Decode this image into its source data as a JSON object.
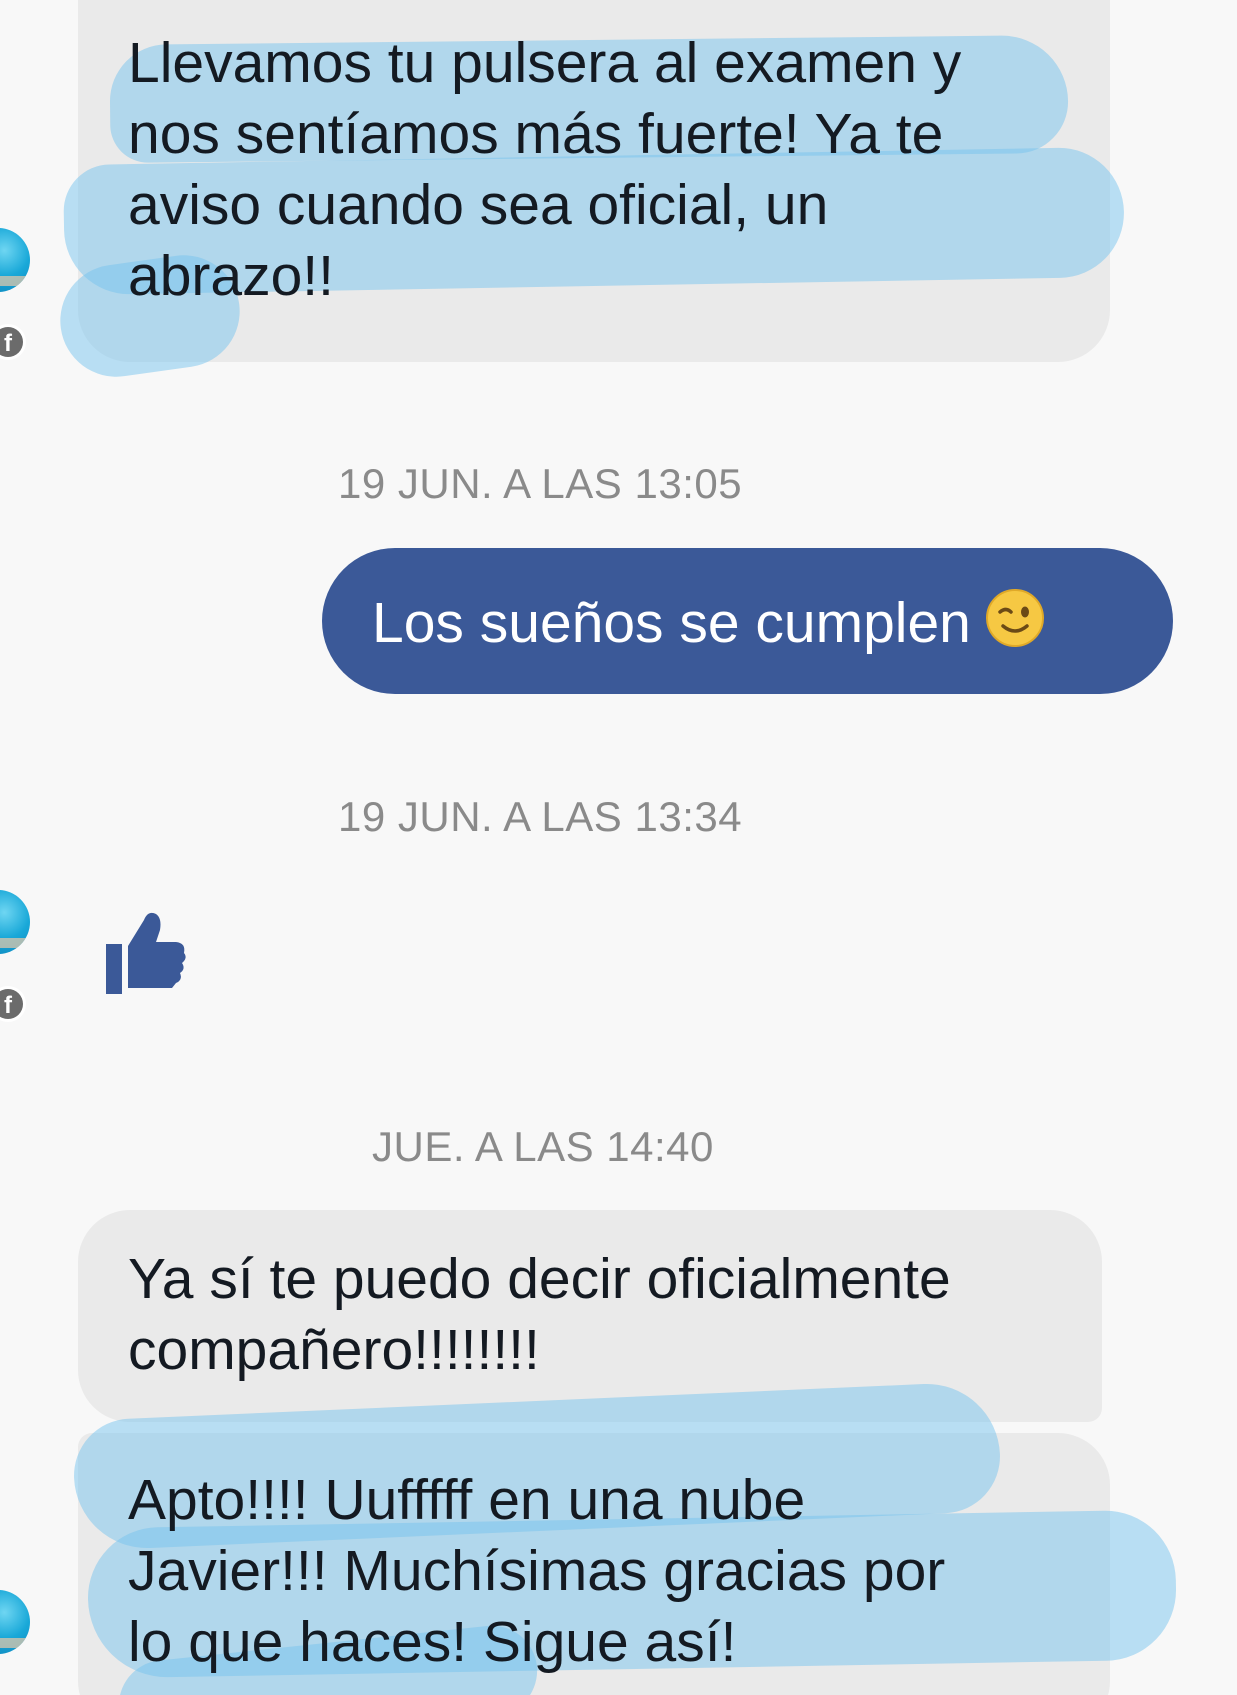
{
  "messages": [
    {
      "direction": "incoming",
      "text": "Llevamos tu pulsera al examen y\nnos sentíamos más fuerte! Ya te\naviso cuando sea oficial, un\nabrazo!!"
    },
    {
      "timestamp": "19 JUN. A LAS 13:05"
    },
    {
      "direction": "outgoing",
      "text": "Los sueños se cumplen",
      "emoji": "winking-face-emoji"
    },
    {
      "timestamp": "19 JUN. A LAS 13:34"
    },
    {
      "direction": "incoming",
      "sticker": "thumbs-up-icon"
    },
    {
      "timestamp": "JUE. A LAS 14:40"
    },
    {
      "direction": "incoming",
      "text": "Ya sí te puedo decir oficialmente\ncompañero!!!!!!!!"
    },
    {
      "direction": "incoming",
      "text": "Apto!!!! Uufffff en una nube\nJavier!!! Muchísimas gracias por\nlo que haces! Sigue así!"
    }
  ],
  "colors": {
    "background": "#f8f8f8",
    "incoming_bubble": "#eaeaea",
    "outgoing_bubble": "#3b5998",
    "highlight": "#78c3ee",
    "timestamp": "#8a8a8a",
    "like_icon": "#3b5998"
  },
  "icons": {
    "avatar_badge": "facebook-icon",
    "like": "thumbs-up-icon",
    "emoji": "winking-face-emoji"
  }
}
